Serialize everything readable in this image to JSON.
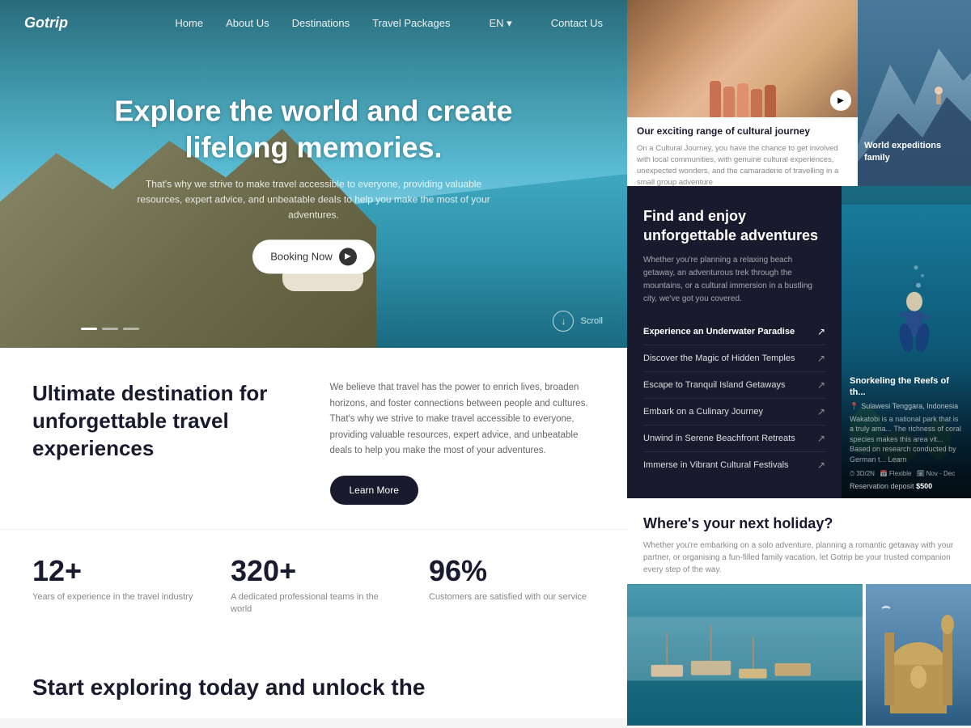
{
  "brand": {
    "logo": "Gotrip"
  },
  "nav": {
    "links": [
      "Home",
      "About Us",
      "Destinations",
      "Travel Packages"
    ],
    "lang": "EN ▾",
    "contact": "Contact Us"
  },
  "hero": {
    "title": "Explore the world and create lifelong memories.",
    "subtitle": "That's why we strive to make travel accessible to everyone, providing valuable resources, expert advice, and unbeatable deals to help you make the most of your adventures.",
    "cta_button": "Booking Now",
    "scroll_label": "Scroll"
  },
  "about": {
    "title": "Ultimate destination for unforgettable travel experiences",
    "text": "We believe that travel has the power to enrich lives, broaden horizons, and foster connections between people and cultures. That's why we strive to make travel accessible to everyone, providing valuable resources, expert advice, and unbeatable deals to help you make the most of your adventures.",
    "learn_more": "Learn More"
  },
  "stats": [
    {
      "number": "12+",
      "label": "Years of experience in the travel industry"
    },
    {
      "number": "320+",
      "label": "A dedicated professional teams in the world"
    },
    {
      "number": "96%",
      "label": "Customers are satisfied with our service"
    }
  ],
  "cta": {
    "title": "Start exploring today and unlock the"
  },
  "cultural_card": {
    "title": "Our exciting range of cultural journey",
    "text": "On a Cultural Journey, you have the chance to get involved with local communities, with genuine cultural experiences, unexpected wonders, and the camaraderie of travelling in a small group adventure"
  },
  "expeditions_card": {
    "title": "World expeditions family"
  },
  "adventure": {
    "title": "Find and enjoy unforgettable adventures",
    "subtitle": "Whether you're planning a relaxing beach getaway, an adventurous trek through the mountains, or a cultural immersion in a bustling city, we've got you covered.",
    "items": [
      {
        "label": "Experience an Underwater Paradise",
        "active": true
      },
      {
        "label": "Discover the Magic of Hidden Temples",
        "active": false
      },
      {
        "label": "Escape to Tranquil Island Getaways",
        "active": false
      },
      {
        "label": "Embark on a Culinary Journey",
        "active": false
      },
      {
        "label": "Unwind in Serene Beachfront Retreats",
        "active": false
      },
      {
        "label": "Immerse in Vibrant Cultural Festivals",
        "active": false
      }
    ]
  },
  "snorkeling": {
    "title": "Snorkeling the Reefs of th...",
    "location": "Sulawesi Tenggara, Indonesia",
    "description": "Wakatobi is a national park that is a truly ama... The richness of coral species makes this area vit... Based on research conducted by German t... Learn",
    "tags": [
      "3D/2N",
      "Flexible",
      "Nov - Dec"
    ],
    "deposit_label": "Reservation deposit",
    "deposit_amount": "$500"
  },
  "holiday": {
    "title": "Where's your next holiday?",
    "subtitle": "Whether you're embarking on a solo adventure, planning a romantic getaway with your partner, or organising a fun-filled family vacation, let Gotrip be your trusted companion every step of the way."
  }
}
